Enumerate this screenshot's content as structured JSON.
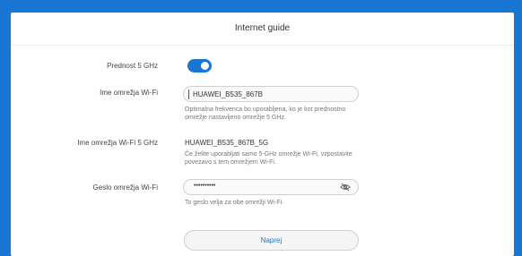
{
  "header": {
    "title": "Internet guide"
  },
  "priority": {
    "label": "Prednost 5 GHz",
    "enabled": true
  },
  "ssid": {
    "label": "Ime omrežja Wi-Fi",
    "value": "HUAWEI_B535_867B",
    "hint": "Optimalna frekvenca bo uporabljena, ko je kot prednostno omrežje nastavljeno omrežje 5 GHz."
  },
  "ssid5": {
    "label": "Ime omrežja Wi-Fi 5 GHz",
    "value": "HUAWEI_B535_867B_5G",
    "hint": "Če želite uporabljati samo 5-GHz omrežje Wi-Fi, vzpostavite povezavo s tem omrežjem Wi-Fi."
  },
  "password": {
    "label": "Geslo omrežja Wi-Fi",
    "value": "••••••••••",
    "hint": "To geslo velja za obe omrežji Wi-Fi."
  },
  "next": {
    "label": "Naprej"
  },
  "colors": {
    "accent": "#1976d2"
  },
  "icons": {
    "eye": "eye-slash-icon"
  }
}
